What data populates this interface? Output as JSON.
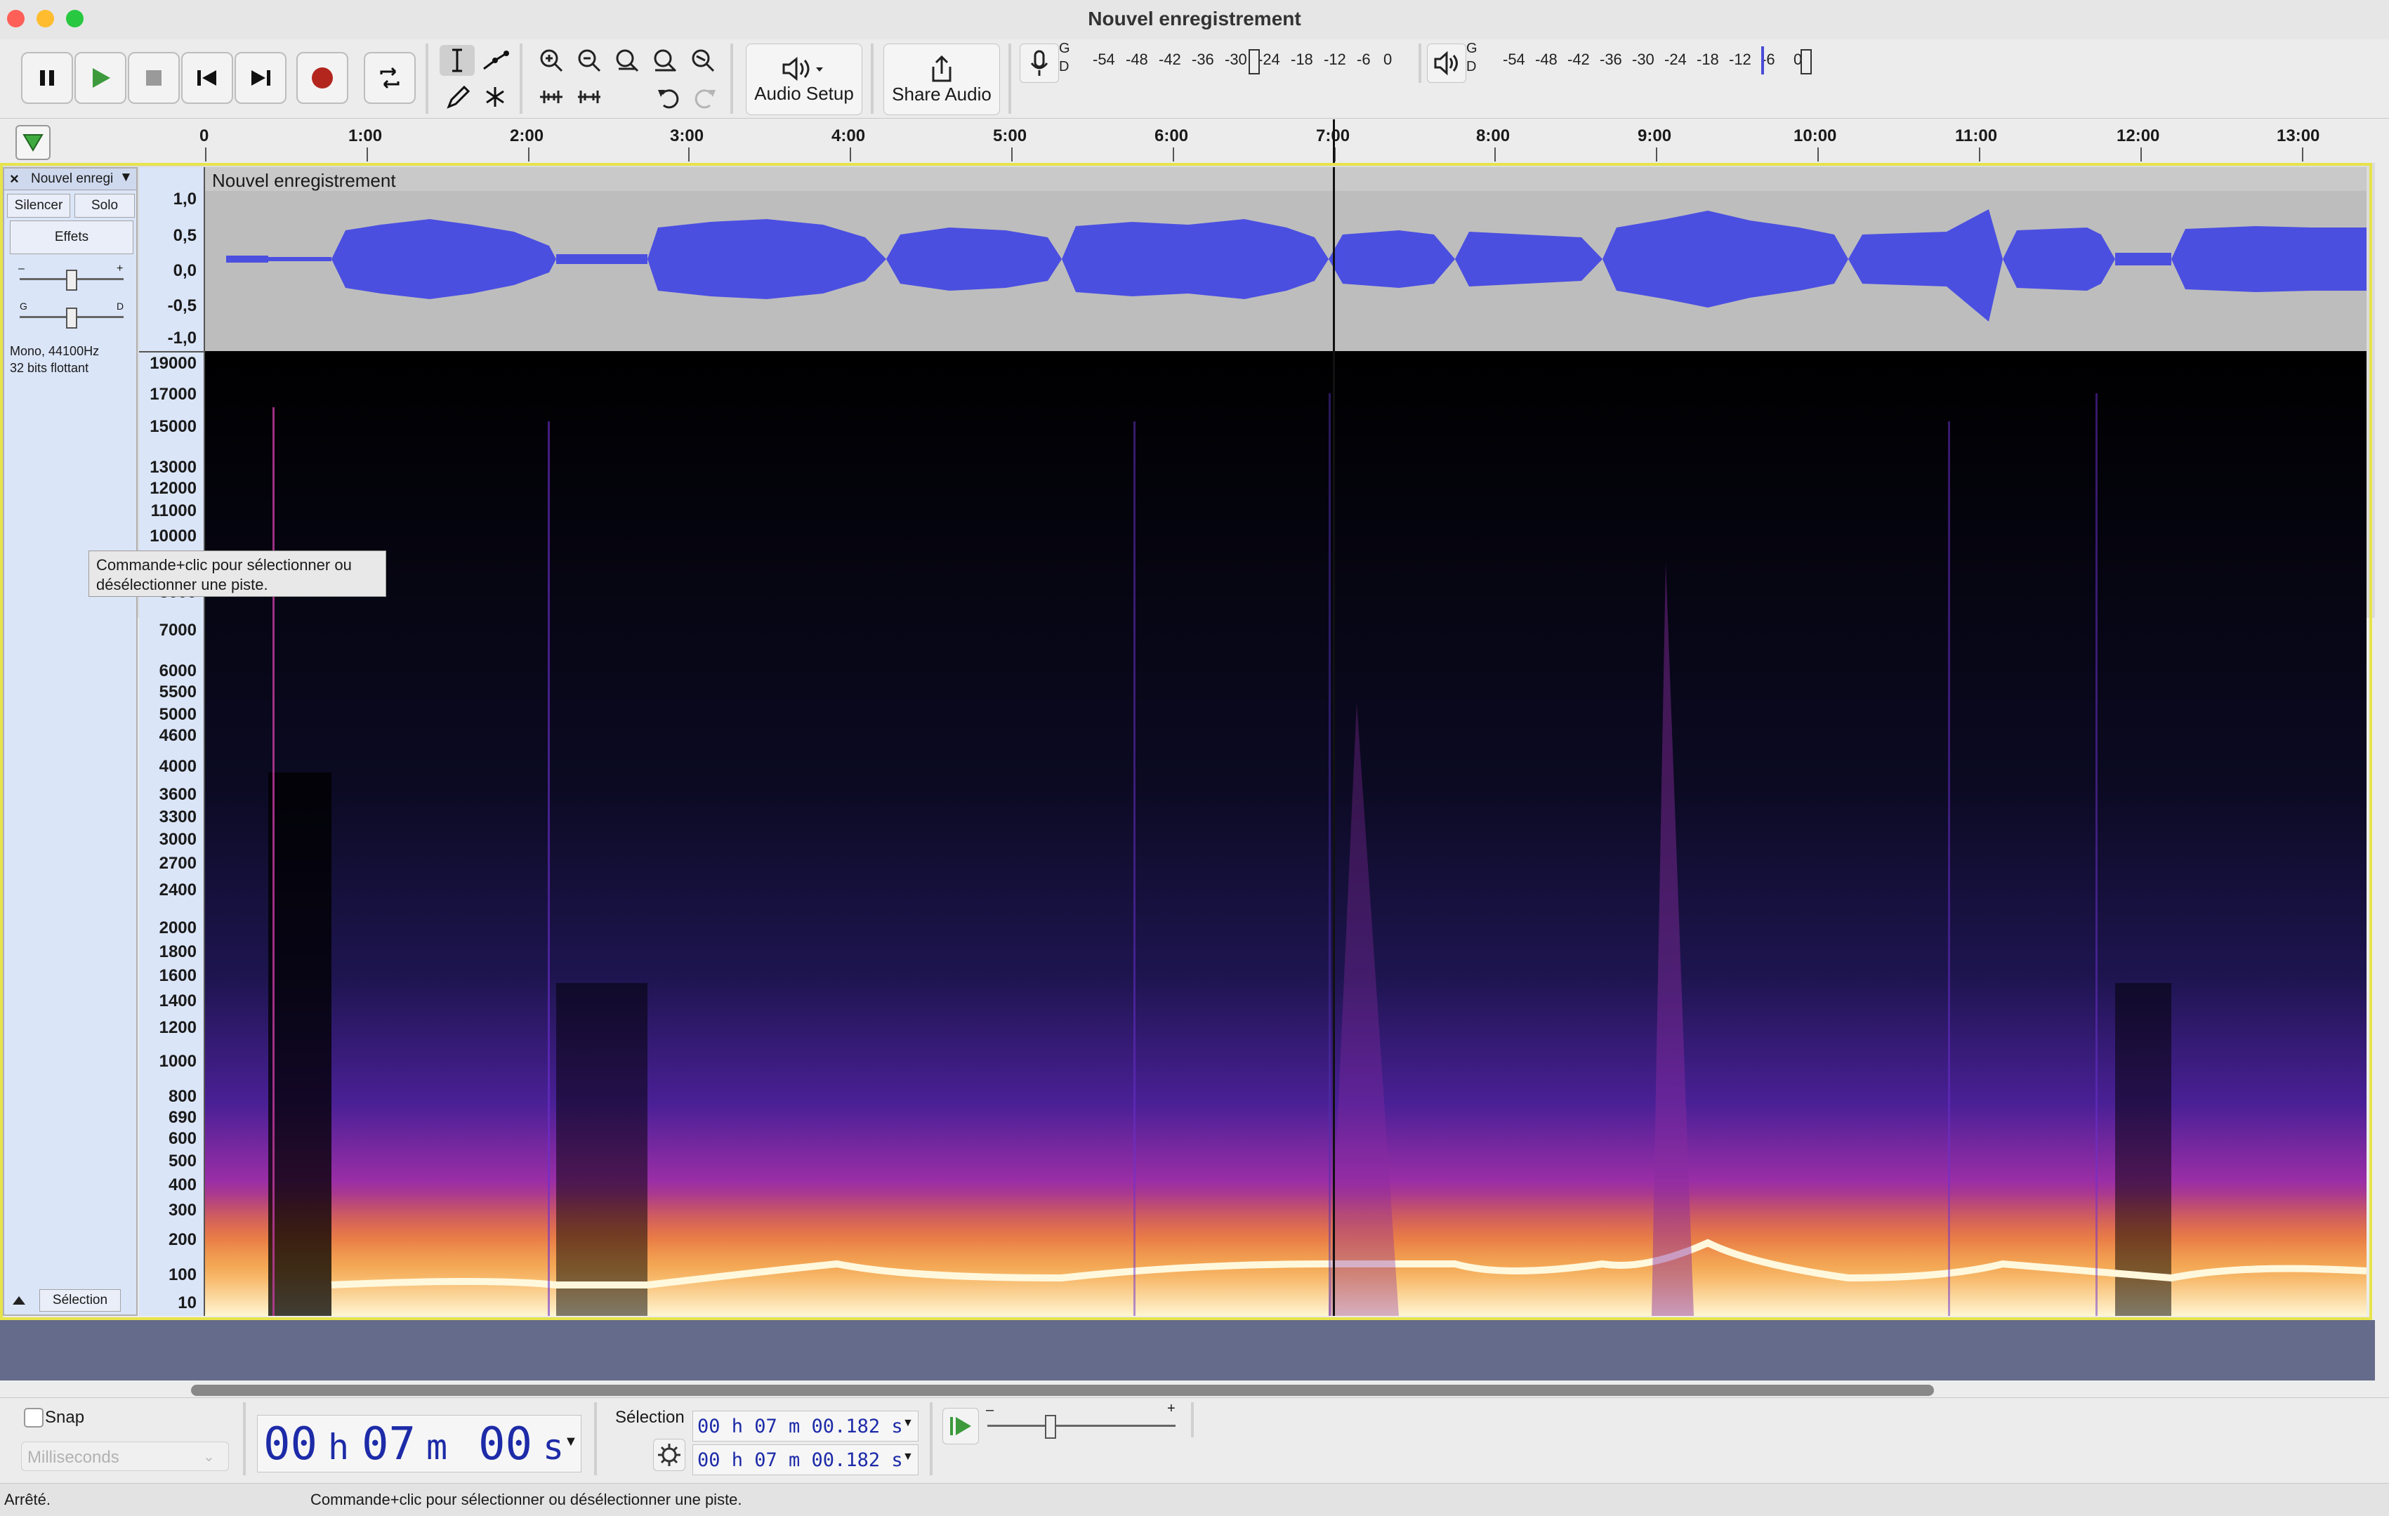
{
  "window": {
    "title": "Nouvel enregistrement"
  },
  "toolbar": {
    "audio_setup_label": "Audio Setup",
    "share_audio_label": "Share Audio",
    "rec_meter_lr": "G\nD",
    "rec_meter_ticks": [
      "-54",
      "-48",
      "-42",
      "-36",
      "-30",
      "-24",
      "-18",
      "-12",
      "-6",
      "0"
    ],
    "play_meter_ticks": [
      "-54",
      "-48",
      "-42",
      "-36",
      "-30",
      "-24",
      "-18",
      "-12",
      "-6",
      "0"
    ],
    "meter_l": "G",
    "meter_r": "D"
  },
  "ruler": {
    "ticks": [
      "0",
      "1:00",
      "2:00",
      "3:00",
      "4:00",
      "5:00",
      "6:00",
      "7:00",
      "8:00",
      "9:00",
      "10:00",
      "11:00",
      "12:00",
      "13:00"
    ]
  },
  "track": {
    "name": "Nouvel enregi",
    "clip_name": "Nouvel enregistrement",
    "mute_label": "Silencer",
    "solo_label": "Solo",
    "effects_label": "Effets",
    "gain_minus": "–",
    "gain_plus": "+",
    "pan_left": "G",
    "pan_right": "D",
    "info_line1": "Mono, 44100Hz",
    "info_line2": "32 bits flottant",
    "select_label": "Sélection",
    "wave_scale": [
      "1,0",
      "0,5",
      "0,0",
      "-0,5",
      "-1,0"
    ],
    "spectro_scale": [
      "19000",
      "17000",
      "15000",
      "13000",
      "12000",
      "11000",
      "10000",
      "8000",
      "7000",
      "6000",
      "5500",
      "5000",
      "4600",
      "4000",
      "3600",
      "3300",
      "3000",
      "2700",
      "2400",
      "2000",
      "1800",
      "1600",
      "1400",
      "1200",
      "1000",
      "800",
      "690",
      "600",
      "500",
      "400",
      "300",
      "200",
      "100",
      "10"
    ]
  },
  "tooltip": {
    "line1": "Commande+clic pour sélectionner ou",
    "line2": "désélectionner une piste."
  },
  "bottom": {
    "snap_label": "Snap",
    "snap_unit": "Milliseconds",
    "time_h": "00",
    "time_m": "07",
    "time_s": "00",
    "unit_h": "h",
    "unit_m": "m",
    "unit_s": "s",
    "selection_label": "Sélection",
    "sel_start": "00 h 07 m 00.182 s",
    "sel_end": "00 h 07 m 00.182 s"
  },
  "status": {
    "state": "Arrêté.",
    "message": "Commande+clic pour sélectionner ou désélectionner une piste."
  },
  "colors": {
    "waveform": "#4b4fe0",
    "track_selected_border": "#e7e34b",
    "spectro_hot": "#fff4c8"
  }
}
